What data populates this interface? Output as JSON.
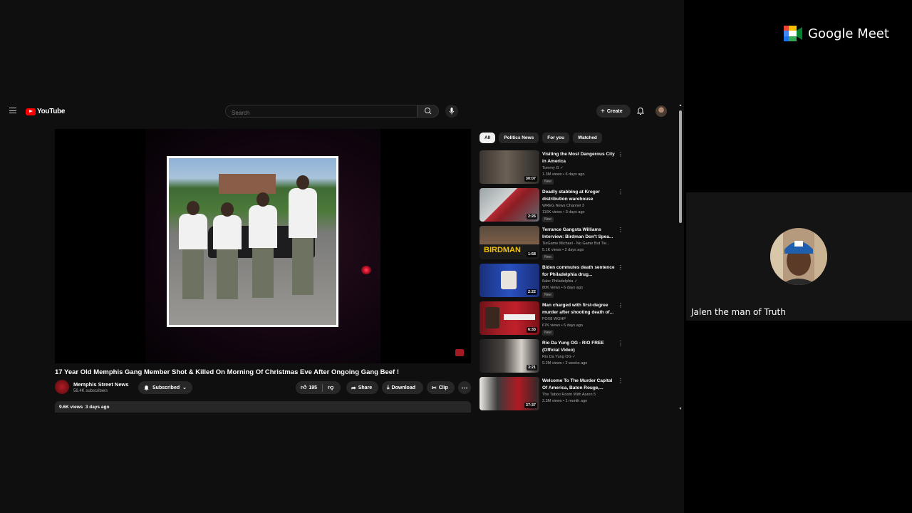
{
  "meet": {
    "logo_text": "Google Meet",
    "participant_name": "Jalen the man of Truth"
  },
  "youtube": {
    "logo_text": "YouTube",
    "search_placeholder": "Search",
    "create_label": "Create",
    "video": {
      "title": "17 Year Old Memphis Gang Member Shot & Killed On Morning Of Christmas Eve After Ongoing Gang Beef !",
      "channel": "Memphis Street News",
      "subscribers": "56.4K subscribers",
      "subscribe_label": "Subscribed",
      "likes": "195",
      "share_label": "Share",
      "download_label": "Download",
      "clip_label": "Clip",
      "views_date": "9.6K views  3 days ago"
    },
    "chips": [
      "All",
      "Politics News",
      "For you",
      "Watched"
    ],
    "recommendations": [
      {
        "title": "Visiting the Most Dangerous City in America",
        "channel": "Tommy G",
        "meta": "1.3M views • 6 days ago",
        "badge": "New",
        "duration": "30:07"
      },
      {
        "title": "Deadly stabbing at Kroger distribution warehouse",
        "channel": "WREG News Channel 3",
        "meta": "116K views • 3 days ago",
        "badge": "New",
        "duration": "2:26"
      },
      {
        "title": "Terrance Gangsta Williams Interview: Birdman Don't Spea...",
        "channel": "TieGame Michael - No Game But Tie...",
        "meta": "5.1K views • 2 days ago",
        "badge": "New",
        "duration": "1:58"
      },
      {
        "title": "Biden commutes death sentence for Philadelphia drug...",
        "channel": "6abc Philadelphia",
        "meta": "80K views • 6 days ago",
        "badge": "New",
        "duration": "2:22"
      },
      {
        "title": "Man charged with first-degree murder after shooting death of...",
        "channel": "FOX8 WGHP",
        "meta": "67K views • 6 days ago",
        "badge": "New",
        "duration": "6:33"
      },
      {
        "title": "Rio Da Yung OG - RIO FREE (Official Video)",
        "channel": "Rio Da Yung OG",
        "meta": "9.2M views • 2 weeks ago",
        "badge": "",
        "duration": "3:21"
      },
      {
        "title": "Welcome To The Murder Capital Of America, Baton Rouge,...",
        "channel": "The Taboo Room With Aaron 5",
        "meta": "2.3M views • 1 month ago",
        "badge": "",
        "duration": "37:37"
      }
    ]
  },
  "colors": {
    "youtube_red": "#ff0000",
    "chip_bg": "#272727",
    "active_chip_bg": "#f1f1f1"
  }
}
